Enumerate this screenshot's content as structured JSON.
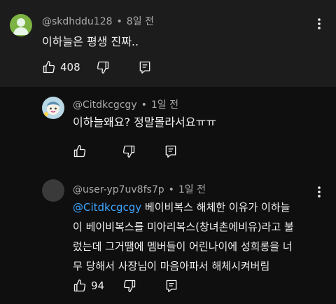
{
  "comments": [
    {
      "author": "@skdhddu128",
      "time": "8일 전",
      "text": "이하늘은 평생 진짜..",
      "likes": "408",
      "avatar_color": "#7cb342"
    },
    {
      "author": "@Citdkcgcgy",
      "time": "1일 전",
      "text": "이하늘왜요? 정말몰라서요ㅠㅠ",
      "likes": "",
      "avatar_color": "#9cc4d8"
    },
    {
      "author": "@user-yp7uv8fs7p",
      "time": "1일 전",
      "mention": "@Citdkcgcgy",
      "lines": [
        " 베이비복스 해체한 이유가 이하늘",
        "이 베이비복스를 미아리복스(창녀촌에비유)라고 불",
        "렀는데 그거땜에 멤버들이 어린나이에 성희롱을 너",
        "무 당해서 사장님이 마음아파서 해체시켜버림"
      ],
      "likes": "94",
      "avatar_color": "#3a3a3a"
    }
  ],
  "separator": "•"
}
